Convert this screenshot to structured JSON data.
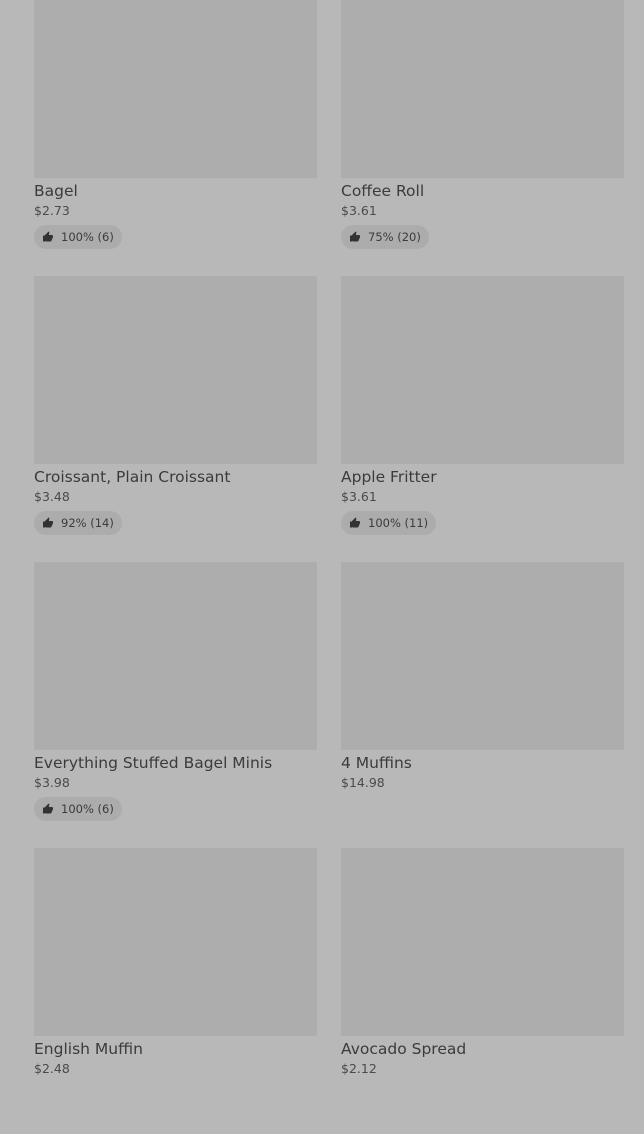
{
  "products": [
    {
      "name": "Bagel",
      "price": "$2.73",
      "rating": "100% (6)"
    },
    {
      "name": "Coffee Roll",
      "price": "$3.61",
      "rating": "75% (20)"
    },
    {
      "name": "Croissant, Plain Croissant",
      "price": "$3.48",
      "rating": "92% (14)"
    },
    {
      "name": "Apple Fritter",
      "price": "$3.61",
      "rating": "100% (11)"
    },
    {
      "name": "Everything Stuffed Bagel Minis",
      "price": "$3.98",
      "rating": "100% (6)"
    },
    {
      "name": "4 Muffins",
      "price": "$14.98",
      "rating": ""
    },
    {
      "name": "English Muffin",
      "price": "$2.48",
      "rating": ""
    },
    {
      "name": "Avocado Spread",
      "price": "$2.12",
      "rating": ""
    }
  ],
  "icons": {
    "rating": "thumbs-up-icon"
  }
}
